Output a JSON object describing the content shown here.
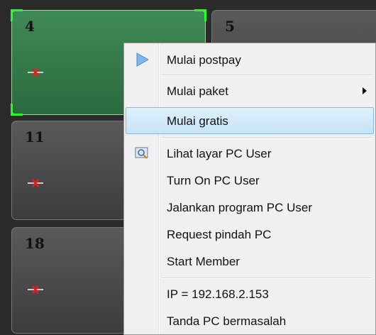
{
  "tiles": [
    {
      "number": "4",
      "status_icon": "red-x-icon",
      "selected": true
    },
    {
      "number": "5"
    },
    {
      "number": "11",
      "status_icon": "red-x-icon"
    },
    {
      "number": "18",
      "status_icon": "red-x-icon"
    }
  ],
  "context_menu": {
    "items": [
      {
        "label": "Mulai postpay",
        "icon": "play-icon"
      },
      {
        "label": "Mulai paket",
        "submenu": true
      },
      {
        "label": "Mulai gratis",
        "highlighted": true
      },
      {
        "label": "Lihat layar PC User",
        "icon": "screen-view-icon"
      },
      {
        "label": "Turn On PC User"
      },
      {
        "label": "Jalankan program PC User"
      },
      {
        "label": "Request pindah PC"
      },
      {
        "label": "Start Member"
      },
      {
        "label": "IP = 192.168.2.153"
      },
      {
        "label": "Tanda PC bermasalah"
      }
    ]
  },
  "colors": {
    "selection_corner": "#22ff22",
    "tile_active": "#3f8a56",
    "menu_highlight": "#c7e3f8"
  }
}
